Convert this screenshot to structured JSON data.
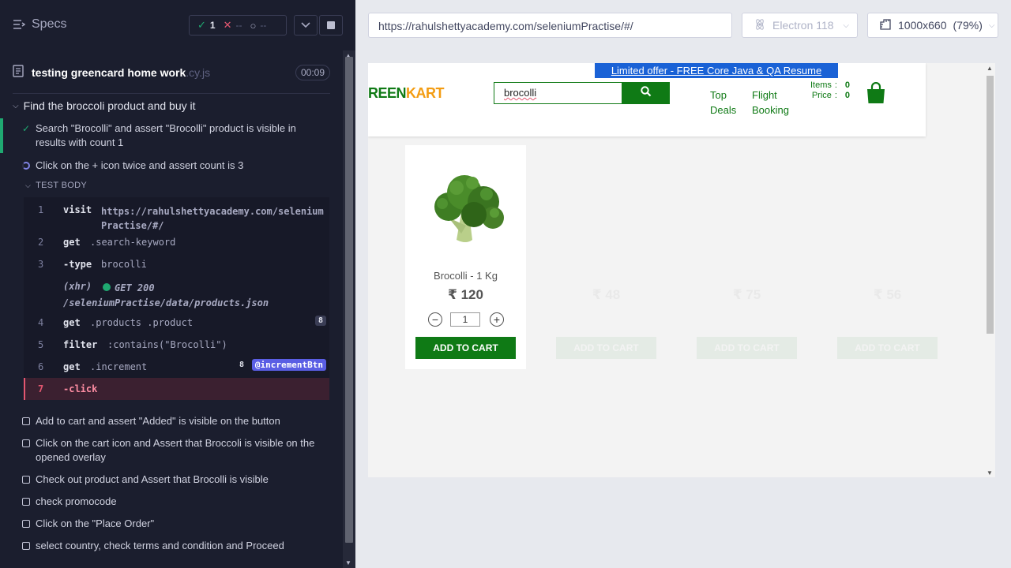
{
  "reporter": {
    "specs_label": "Specs",
    "stats": {
      "passed": "1",
      "failed": "--",
      "pending": "--"
    },
    "spec": {
      "name": "testing greencard home work",
      "ext": ".cy.js",
      "duration": "00:09"
    },
    "suite_title": "Find the broccoli product and buy it",
    "tests": [
      {
        "title": "Search \"Brocolli\" and assert \"Brocolli\" product is visible in results with count 1",
        "state": "passed"
      },
      {
        "title": "Click on the + icon twice and assert count is 3",
        "state": "running"
      },
      {
        "title": "Add to cart and assert \"Added\" is visible on the button",
        "state": "pending"
      },
      {
        "title": "Click on the cart icon and Assert that Broccoli is visible on the opened overlay",
        "state": "pending"
      },
      {
        "title": "Check out product and Assert that Brocolli is visible",
        "state": "pending"
      },
      {
        "title": "check promocode",
        "state": "pending"
      },
      {
        "title": "Click on the \"Place Order\"",
        "state": "pending"
      },
      {
        "title": "select country, check terms and condition and Proceed",
        "state": "pending"
      }
    ],
    "test_body_label": "TEST BODY",
    "commands": [
      {
        "num": "1",
        "method": "visit",
        "message": "https://rahulshettyacademy.com/seleniumPractise/#/"
      },
      {
        "num": "2",
        "method": "get",
        "message": ".search-keyword"
      },
      {
        "num": "3",
        "method": "-type",
        "message": "brocolli"
      },
      {
        "num": "",
        "method": "(xhr)",
        "message": "GET 200 /seleniumPractise/data/products.json"
      },
      {
        "num": "4",
        "method": "get",
        "message": ".products .product",
        "badge": "8"
      },
      {
        "num": "5",
        "method": "filter",
        "message": ":contains(\"Brocolli\")"
      },
      {
        "num": "6",
        "method": "get",
        "message": ".increment",
        "badge": "8",
        "alias": "@incrementBtn"
      },
      {
        "num": "7",
        "method": "-click",
        "message": ""
      }
    ]
  },
  "aut": {
    "url": "https://rahulshettyacademy.com/seleniumPractise/#/",
    "browser": "Electron 118",
    "viewport": "1000x660",
    "zoom": "(79%)",
    "site": {
      "offer": "Limited offer - FREE Core Java & QA Resume course",
      "brand_green": "REEN",
      "brand_orange": "KART",
      "search_value": "brocolli",
      "nav": [
        {
          "line1": "Top",
          "line2": "Deals"
        },
        {
          "line1": "Flight",
          "line2": "Booking"
        }
      ],
      "items_label": "Items",
      "items_value": "0",
      "price_label": "Price",
      "price_value": "0",
      "product": {
        "name": "Brocolli - 1 Kg",
        "price": "₹ 120",
        "qty": "1",
        "add_label": "ADD TO CART"
      },
      "ghost_products": [
        {
          "price": "₹ 48"
        },
        {
          "price": "₹ 75"
        },
        {
          "price": "₹ 56"
        }
      ]
    }
  },
  "colors": {
    "pass": "#1fa971",
    "fail": "#e45770",
    "accent": "#5a5ee4",
    "brand_green": "#0f7a15",
    "brand_orange": "#f39c12"
  }
}
